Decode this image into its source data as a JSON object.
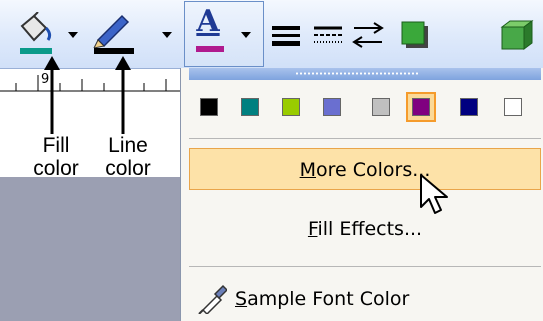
{
  "toolbar": {
    "fill_color_icon": "paint-bucket",
    "fill_color_bar": "#0b9a8a",
    "line_color_icon": "pen",
    "line_color_bar": "#000000",
    "font_color_bar": "#b01a8e",
    "font_letter": "A",
    "buttons": [
      "line-style-icon",
      "dash-style-icon",
      "arrow-style-icon",
      "shadow-icon",
      "3d-icon"
    ]
  },
  "ruler": {
    "label": "9"
  },
  "captions": {
    "fill_line1": "Fill",
    "fill_line2": "color",
    "line_line1": "Line",
    "line_line2": "color"
  },
  "menu": {
    "swatches": [
      "#000000",
      "#008080",
      "#99cc00",
      "#6a6fd0",
      "#c0c0c0",
      "#800080",
      "#000080",
      "#ffffff"
    ],
    "selected_swatch_index": 5,
    "more_colors_label": "More Colors...",
    "more_colors_accel": "M",
    "more_colors_rest": "ore Colors...",
    "fill_effects_accel": "F",
    "fill_effects_rest": "ill Effects...",
    "sample_accel": "S",
    "sample_rest": "ample Font Color"
  }
}
